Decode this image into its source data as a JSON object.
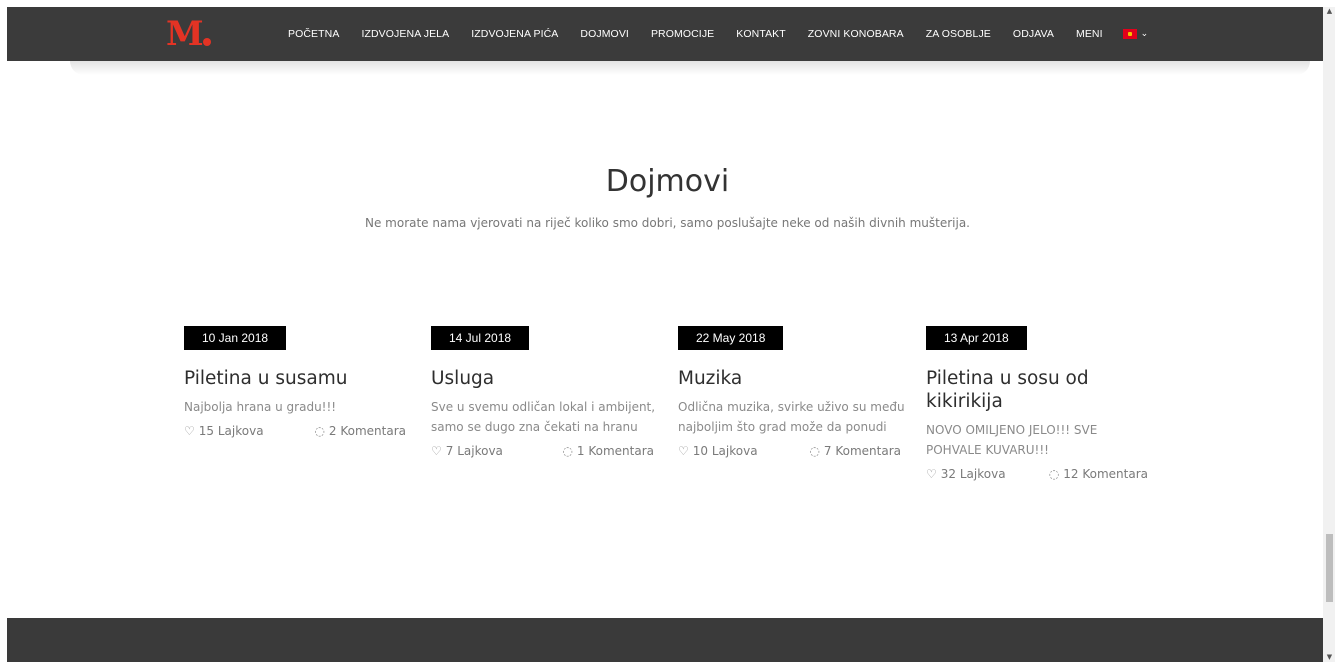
{
  "logo": {
    "text": "M"
  },
  "nav": {
    "items": [
      {
        "label": "POČETNA"
      },
      {
        "label": "IZDVOJENA JELA"
      },
      {
        "label": "IZDVOJENA PIĆA"
      },
      {
        "label": "DOJMOVI"
      },
      {
        "label": "PROMOCIJE"
      },
      {
        "label": "KONTAKT"
      },
      {
        "label": "ZOVNI KONOBARA"
      },
      {
        "label": "ZA OSOBLJE"
      },
      {
        "label": "ODJAVA"
      },
      {
        "label": "MENI"
      }
    ],
    "language": {
      "icon": "croatian-flag-icon",
      "chevron": "⌄"
    }
  },
  "section": {
    "title": "Dojmovi",
    "subtitle": "Ne morate nama vjerovati na riječ koliko smo dobri, samo poslušajte neke od naših divnih mušterija."
  },
  "reviews": [
    {
      "date": "10 Jan 2018",
      "title": "Piletina u susamu",
      "text": "Najbolja hrana u gradu!!!",
      "likes": "15 Lajkova",
      "comments": "2 Komentara"
    },
    {
      "date": "14 Jul 2018",
      "title": "Usluga",
      "text": "Sve u svemu odličan lokal i ambijent, samo se dugo zna čekati na hranu",
      "likes": "7 Lajkova",
      "comments": "1 Komentara"
    },
    {
      "date": "22 May 2018",
      "title": "Muzika",
      "text": "Odlična muzika, svirke uživo su među najboljim što grad može da ponudi",
      "likes": "10 Lajkova",
      "comments": "7 Komentara"
    },
    {
      "date": "13 Apr 2018",
      "title": "Piletina u sosu od kikirikija",
      "text": "NOVO OMILJENO JELO!!! SVE POHVALE KUVARU!!!",
      "likes": "32 Lajkova",
      "comments": "12 Komentara"
    }
  ],
  "icons": {
    "like": "heart-icon",
    "comment": "comment-bubble-icon"
  },
  "colors": {
    "accent": "#e33324",
    "navbar": "#3b3b3b",
    "footer": "#3a3a3a"
  }
}
